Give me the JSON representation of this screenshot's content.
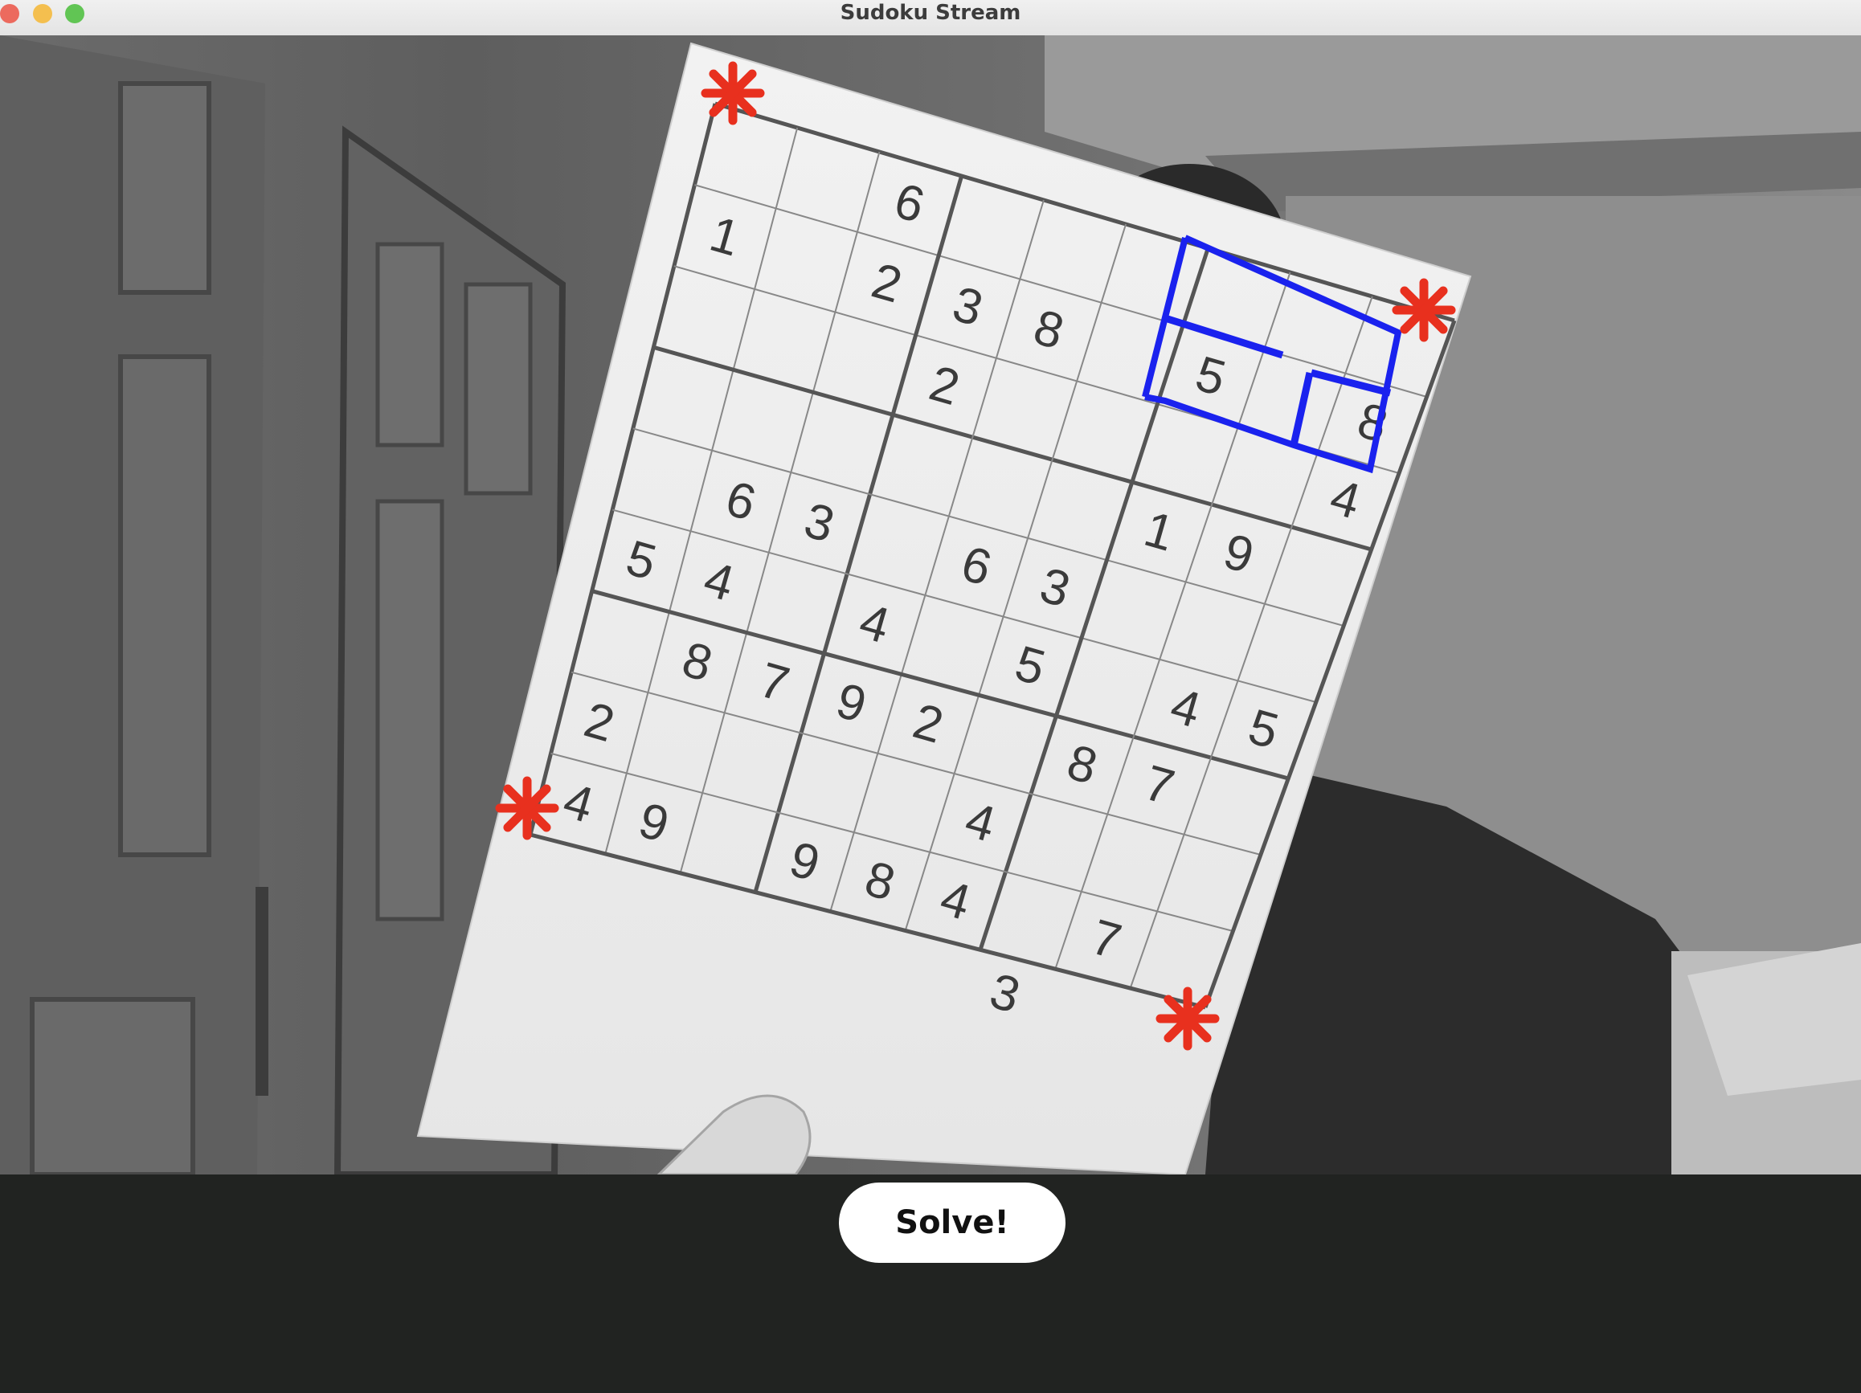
{
  "window": {
    "title": "Sudoku Stream",
    "controls": [
      {
        "name": "close-button",
        "color": "#ec6a5e"
      },
      {
        "name": "minimize-button",
        "color": "#f4bf4f"
      },
      {
        "name": "maximize-button",
        "color": "#61c554"
      }
    ]
  },
  "video": {
    "description_icon": "camera-feed",
    "corner_marker_color": "#e8301e",
    "selection_color": "#1a22ee",
    "grid_rows": [
      [
        "",
        "",
        "6",
        "",
        "",
        "",
        "",
        "",
        ""
      ],
      [
        "1",
        "",
        "2",
        "3",
        "8",
        "",
        "5",
        "",
        "8"
      ],
      [
        "",
        "",
        "",
        "2",
        "",
        "",
        "",
        "",
        "4"
      ],
      [
        "",
        "",
        "",
        "",
        "",
        "",
        "1",
        "9",
        ""
      ],
      [
        "",
        "6",
        "3",
        "",
        "6",
        "3",
        "",
        "",
        ""
      ],
      [
        "5",
        "4",
        "",
        "4",
        "",
        "5",
        "",
        "4",
        "5"
      ],
      [
        "",
        "8",
        "7",
        "9",
        "2",
        "",
        "8",
        "7",
        ""
      ],
      [
        "2",
        "",
        "",
        "",
        "",
        "4",
        "",
        "",
        ""
      ],
      [
        "4",
        "9",
        "",
        "9",
        "8",
        "4",
        "",
        "7",
        ""
      ]
    ],
    "extra_digit": "3"
  },
  "solve_button": {
    "label": "Solve!",
    "background": "#ffffff"
  }
}
